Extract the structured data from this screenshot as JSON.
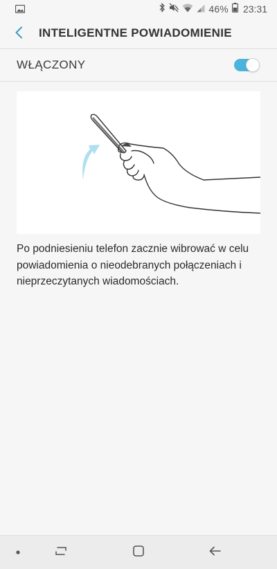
{
  "status_bar": {
    "battery_percent": "46%",
    "time": "23:31",
    "icons": [
      "image-notification-icon",
      "bluetooth-icon",
      "mute-icon",
      "wifi-icon",
      "signal-icon",
      "battery-icon"
    ]
  },
  "app_bar": {
    "title": "INTELIGENTNE POWIADOMIENIE",
    "back_icon": "chevron-left-icon"
  },
  "master_switch": {
    "label": "WŁĄCZONY",
    "state": "on",
    "accent_color": "#4cb3dd"
  },
  "illustration": {
    "description_icon": "hand-lifting-phone-illustration",
    "arrow_color": "#aee0f1"
  },
  "description": {
    "text": "Po podniesieniu telefon zacznie wibrować w celu powiadomienia o nieodebranych połączeniach i nieprzeczytanych wiadomościach."
  },
  "nav_bar": {
    "items": [
      "dot-indicator-icon",
      "recent-apps-icon",
      "home-icon",
      "back-icon"
    ]
  }
}
